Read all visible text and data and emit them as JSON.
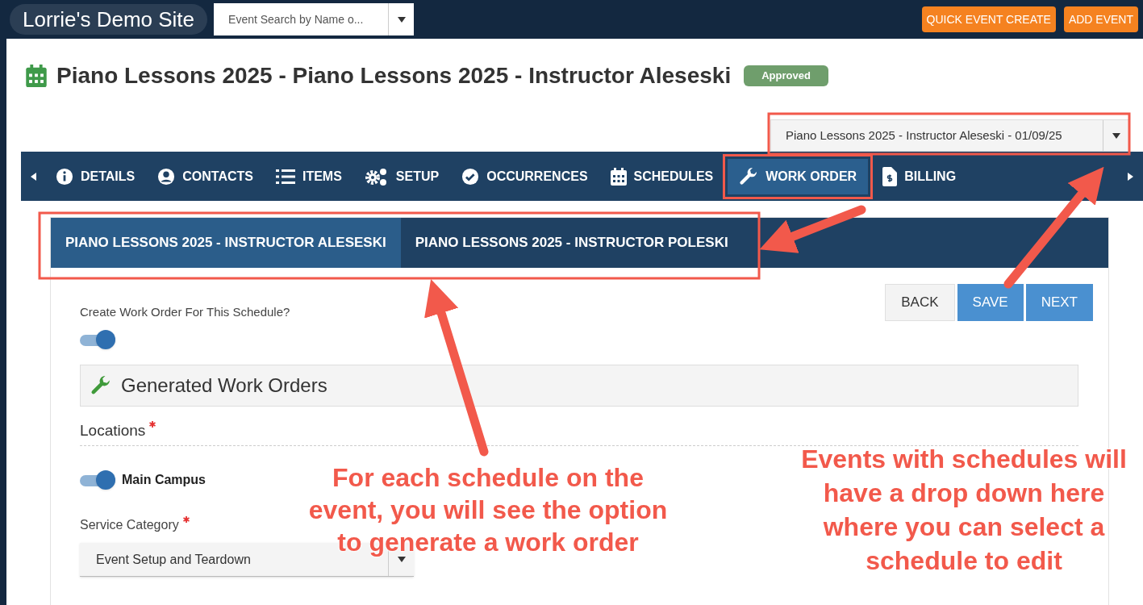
{
  "top_bar": {
    "site_name": "Lorrie's Demo Site",
    "event_search": {
      "value": "Event Search by Name o..."
    },
    "buttons": [
      "QUICK EVENT CREATE",
      "ADD EVENT"
    ]
  },
  "event": {
    "title": "Piano Lessons 2025 - Piano Lessons 2025 - Instructor Aleseski",
    "status": "Approved"
  },
  "schedule_select": {
    "value": "Piano Lessons 2025 - Instructor Aleseski - 01/09/25"
  },
  "tabs": [
    {
      "label": "DETAILS",
      "selected": false
    },
    {
      "label": "CONTACTS",
      "selected": false
    },
    {
      "label": "ITEMS",
      "selected": false
    },
    {
      "label": "SETUP",
      "selected": false
    },
    {
      "label": "OCCURRENCES",
      "selected": false
    },
    {
      "label": "SCHEDULES",
      "selected": false
    },
    {
      "label": "WORK ORDER",
      "selected": true
    },
    {
      "label": "BILLING",
      "selected": false
    }
  ],
  "schedule_tabs": [
    {
      "label": "PIANO LESSONS 2025 - INSTRUCTOR ALESESKI",
      "selected": true
    },
    {
      "label": "PIANO LESSONS 2025 - INSTRUCTOR POLESKI",
      "selected": false
    }
  ],
  "actions": [
    {
      "label": "BACK",
      "kind": "default"
    },
    {
      "label": "SAVE",
      "kind": "primary"
    },
    {
      "label": "NEXT",
      "kind": "primary"
    }
  ],
  "create_work_order": {
    "label": "Create Work Order For This Schedule?",
    "on": true
  },
  "generated_panel": {
    "title": "Generated Work Orders"
  },
  "locations": {
    "label": "Locations",
    "required": true,
    "items": [
      {
        "label": "Main Campus",
        "on": true
      }
    ]
  },
  "service_category": {
    "label": "Service Category",
    "required": true,
    "value": "Event Setup and Teardown"
  },
  "annotations": [
    {
      "text": "For each schedule on the event, you will see the option to generate a work order"
    },
    {
      "text": "Events with schedules will have a drop down here where you can select a schedule to edit"
    }
  ]
}
